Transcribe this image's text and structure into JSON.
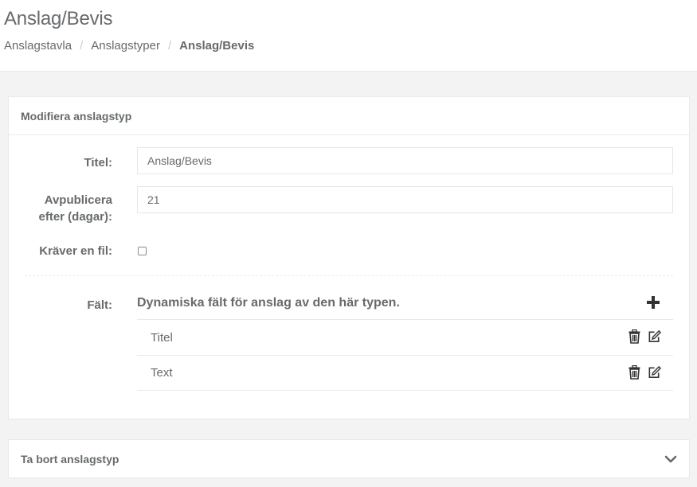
{
  "header": {
    "title": "Anslag/Bevis",
    "breadcrumb": [
      {
        "label": "Anslagstavla"
      },
      {
        "label": "Anslagstyper"
      },
      {
        "label": "Anslag/Bevis"
      }
    ],
    "separator": "/"
  },
  "form_panel": {
    "heading": "Modifiera anslagstyp",
    "title_label": "Titel:",
    "title_value": "Anslag/Bevis",
    "unpublish_label_line1": "Avpublicera",
    "unpublish_label_line2": "efter (dagar):",
    "unpublish_value": "21",
    "requires_file_label": "Kräver en fil:",
    "requires_file_checked": false,
    "fields_label": "Fält:",
    "fields_description": "Dynamiska fält för anslag av den här typen.",
    "fields": [
      {
        "label": "Titel"
      },
      {
        "label": "Text"
      }
    ]
  },
  "delete_panel": {
    "heading": "Ta bort anslagstyp"
  },
  "colors": {
    "text": "#676a6c",
    "border": "#e7eaec",
    "background": "#f3f3f4",
    "icon": "#333333"
  }
}
